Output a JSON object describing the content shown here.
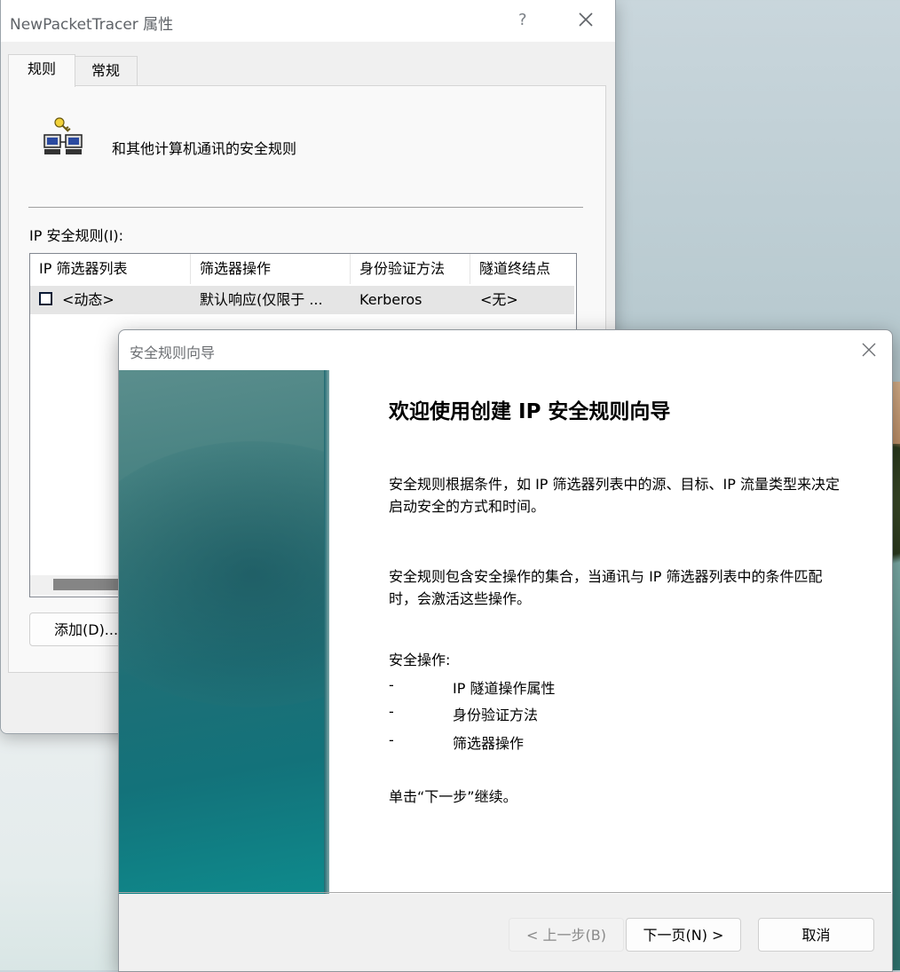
{
  "properties_window": {
    "title": "NewPacketTracer 属性",
    "help_label": "?",
    "tabs": [
      {
        "label": "规则",
        "active": true
      },
      {
        "label": "常规",
        "active": false
      }
    ],
    "rule_description": "和其他计算机通讯的安全规则",
    "list_label": "IP 安全规则(I):",
    "columns": [
      "IP 筛选器列表",
      "筛选器操作",
      "身份验证方法",
      "隧道终结点"
    ],
    "rows": [
      {
        "checked": false,
        "filter_list": "<动态>",
        "filter_action": "默认响应(仅限于 ...",
        "auth": "Kerberos",
        "tunnel": "<无>"
      }
    ],
    "add_button": "添加(D)..."
  },
  "wizard": {
    "title": "安全规则向导",
    "heading": "欢迎使用创建 IP 安全规则向导",
    "paragraph1": "安全规则根据条件，如 IP 筛选器列表中的源、目标、IP 流量类型来决定启动安全的方式和时间。",
    "paragraph2": "安全规则包含安全操作的集合，当通讯与 IP 筛选器列表中的条件匹配时，会激活这些操作。",
    "actions_label": "安全操作:",
    "actions": [
      {
        "dash": "-",
        "text": "IP 隧道操作属性"
      },
      {
        "dash": "-",
        "text": "身份验证方法"
      },
      {
        "dash": "-",
        "text": "筛选器操作"
      }
    ],
    "continue_text": "单击“下一步”继续。",
    "buttons": {
      "prev": "< 上一步(B)",
      "next": "下一页(N) >",
      "cancel": "取消"
    }
  }
}
